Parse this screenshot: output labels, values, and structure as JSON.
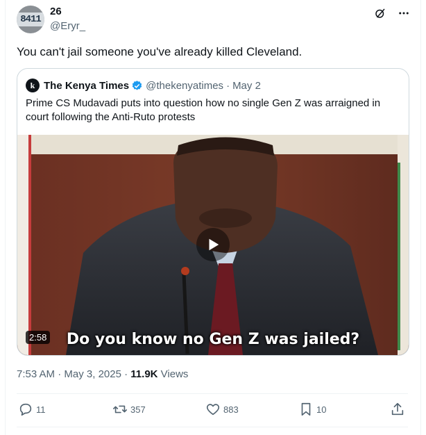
{
  "author": {
    "name": "26",
    "handle": "@Eryr_",
    "avatar_plate_text": "8411"
  },
  "tweet": {
    "text": "You can't jail someone you've already killed Cleveland."
  },
  "quote": {
    "avatar_letter": "k",
    "name": "The Kenya Times",
    "handle": "@thekenyatimes",
    "separator": "·",
    "date": "May 2",
    "text": "Prime CS Mudavadi puts into question how no single Gen Z was arraigned in court following the Anti-Ruto protests",
    "video": {
      "duration": "2:58",
      "caption": "Do you know no Gen Z was jailed?"
    }
  },
  "meta": {
    "time": "7:53 AM",
    "separator": "·",
    "date": "May 3, 2025",
    "views_count": "11.9K",
    "views_label": "Views"
  },
  "actions": {
    "replies": "11",
    "reposts": "357",
    "likes": "883",
    "bookmarks": "10"
  },
  "colors": {
    "text": "#0f1419",
    "secondary": "#536471",
    "border": "#cfd9de",
    "verified": "#1d9bf0"
  },
  "icons": {
    "grok": "grok-icon",
    "more": "more-icon",
    "verified": "verified-badge-icon",
    "play": "play-icon",
    "reply": "reply-icon",
    "repost": "repost-icon",
    "like": "like-icon",
    "bookmark": "bookmark-icon",
    "share": "share-icon"
  }
}
